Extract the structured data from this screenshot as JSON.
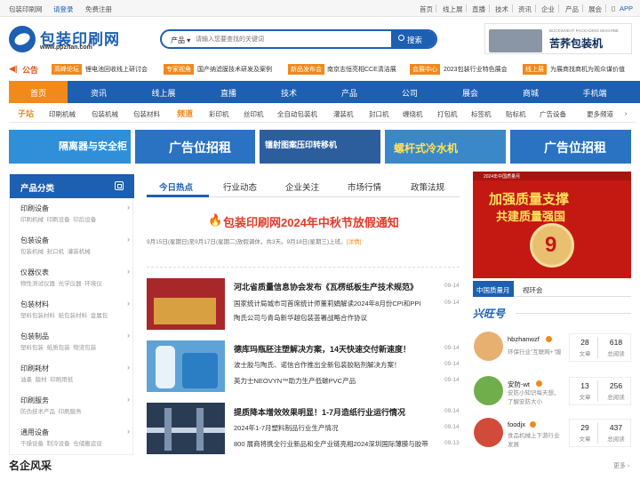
{
  "topbar": {
    "left": [
      "包装印刷网",
      "请登录",
      "免费注册"
    ],
    "right": [
      "首页",
      "线上展",
      "直播",
      "技术",
      "资讯",
      "企业",
      "产品",
      "展会"
    ],
    "app": "APP"
  },
  "logo": {
    "title": "包装印刷网",
    "url": "www.ppzhan.com"
  },
  "search": {
    "category": "产品",
    "placeholder": "请输入您要查找的关键词",
    "button": "搜索"
  },
  "header_ad": {
    "text": "苦荞包装机",
    "sub": "BUCKWHEAT PACKAGING MACHINE"
  },
  "notice": {
    "label": "公告",
    "items": [
      {
        "tag": "高峰论坛",
        "text": "锂电池回收线上研讨会"
      },
      {
        "tag": "专家视角",
        "text": "国产纳滤膜技术研发及案例"
      },
      {
        "tag": "新品发布会",
        "text": "南京志恒亮相CCE清洁展"
      },
      {
        "tag": "会展中心",
        "text": "2023包装行业特色展会"
      },
      {
        "tag": "线上展",
        "text": "为展商找商机为观众谋价值"
      }
    ]
  },
  "nav": [
    "首页",
    "资讯",
    "线上展",
    "直播",
    "技术",
    "产品",
    "公司",
    "展会",
    "商城",
    "手机端"
  ],
  "subnav": {
    "station_label": "子站",
    "stations": [
      "印刷机械",
      "包装机械",
      "包装材料"
    ],
    "channel_label": "频道",
    "channels": [
      "彩印机",
      "丝印机",
      "全自动包装机",
      "灌装机",
      "封口机",
      "缠绕机",
      "打包机",
      "标签机",
      "贴标机",
      "广告设备"
    ],
    "more": "更多频道"
  },
  "banners": [
    {
      "text": "隔离器与安全柜",
      "color": "#2f8fd8"
    },
    {
      "text": "广告位招租",
      "color": "#2a72c2"
    },
    {
      "text": "镭射图案压印转移机",
      "color": "#2c5e9e"
    },
    {
      "text": "螺杆式冷水机",
      "color": "#3a88c8"
    },
    {
      "text": "广告位招租",
      "color": "#2a72c2"
    }
  ],
  "sidebar": {
    "title": "产品分类",
    "categories": [
      {
        "name": "印刷设备",
        "subs": [
          "印刷机械",
          "印刷设备",
          "印后设备"
        ]
      },
      {
        "name": "包装设备",
        "subs": [
          "包装机械",
          "封口机",
          "灌装机械"
        ]
      },
      {
        "name": "仪器仪表",
        "subs": [
          "物性测试仪器",
          "光学仪器",
          "环境仪"
        ]
      },
      {
        "name": "包装材料",
        "subs": [
          "塑料包装材料",
          "纸包装材料",
          "金属包"
        ]
      },
      {
        "name": "包装制品",
        "subs": [
          "塑料包装",
          "纸质包装",
          "物流包装"
        ]
      },
      {
        "name": "印刷耗材",
        "subs": [
          "油墨",
          "版材",
          "印刷用纸"
        ]
      },
      {
        "name": "印刷服务",
        "subs": [
          "防伪技术产品",
          "印刷服务"
        ]
      },
      {
        "name": "通用设备",
        "subs": [
          "干燥设备",
          "制冷设备",
          "仓储搬运设"
        ]
      }
    ]
  },
  "tabs": [
    "今日热点",
    "行业动态",
    "企业关注",
    "市场行情",
    "政策法规"
  ],
  "headline": {
    "title": "包装印刷网2024年中秋节放假通知",
    "desc": "9月15日(星期日)至9月17日(星期二)放假调休，共3天。9月18日(星期三)上班。",
    "link": "[详情]"
  },
  "news_groups": [
    {
      "title": "河北省质量信息协会发布《瓦楞纸板生产技术规范》",
      "title_date": "09-14",
      "lines": [
        {
          "text": "国家统计局城市司首席统计师董莉娟解读2024年8月份CPI和PPI",
          "date": "09-14"
        },
        {
          "text": "陶氏公司与青岛新华越包装荟署战略合作协议",
          "date": ""
        }
      ]
    },
    {
      "title": "德库玛瓶胚注塑解决方案，14天快速交付新速度！",
      "title_date": "09-14",
      "lines": [
        {
          "text": "波士胶与陶氏、诺信合作推出全新包装胶粘剂解决方案！",
          "date": "09-14"
        },
        {
          "text": "英力士NEOVYN™助力生产低碳PVC产品",
          "date": "09-14"
        }
      ]
    },
    {
      "title": "提质降本增效效果明显！1-7月造纸行业运行情况",
      "title_date": "09-14",
      "lines": [
        {
          "text": "2024年1-7月塑料制品行业生产情况",
          "date": "09-14"
        },
        {
          "text": "800 展商将携全行业新品和全产业链亮相2024深圳国际薄膜与胶带",
          "date": "09-13"
        }
      ]
    }
  ],
  "right_banner": {
    "top": "2024年中国质量月",
    "line1": "加强质量支撑",
    "line2": "共建质量强国",
    "medal": "9"
  },
  "right_tabs": [
    "中国质量月",
    "视环会"
  ],
  "xingguang": {
    "title": "兴旺号",
    "users": [
      {
        "name": "hbzhanwzf",
        "desc": "环保行业\"互联网+\"服务平台，为",
        "articles": "28",
        "articles_label": "文章",
        "views": "618",
        "views_label": "总阅读"
      },
      {
        "name": "安防-wt",
        "desc": "安防小知识每天想，了解安防大小",
        "articles": "13",
        "articles_label": "文章",
        "views": "256",
        "views_label": "总阅读"
      },
      {
        "name": "foodjx",
        "desc": "食品机械上下游行业发展",
        "articles": "29",
        "articles_label": "文章",
        "views": "437",
        "views_label": "总阅读"
      }
    ]
  },
  "bottom": {
    "title": "名企风采",
    "more": "更多"
  },
  "colors": {
    "primary": "#1d5fb0",
    "accent": "#f28a1b",
    "red": "#e23b2a"
  }
}
